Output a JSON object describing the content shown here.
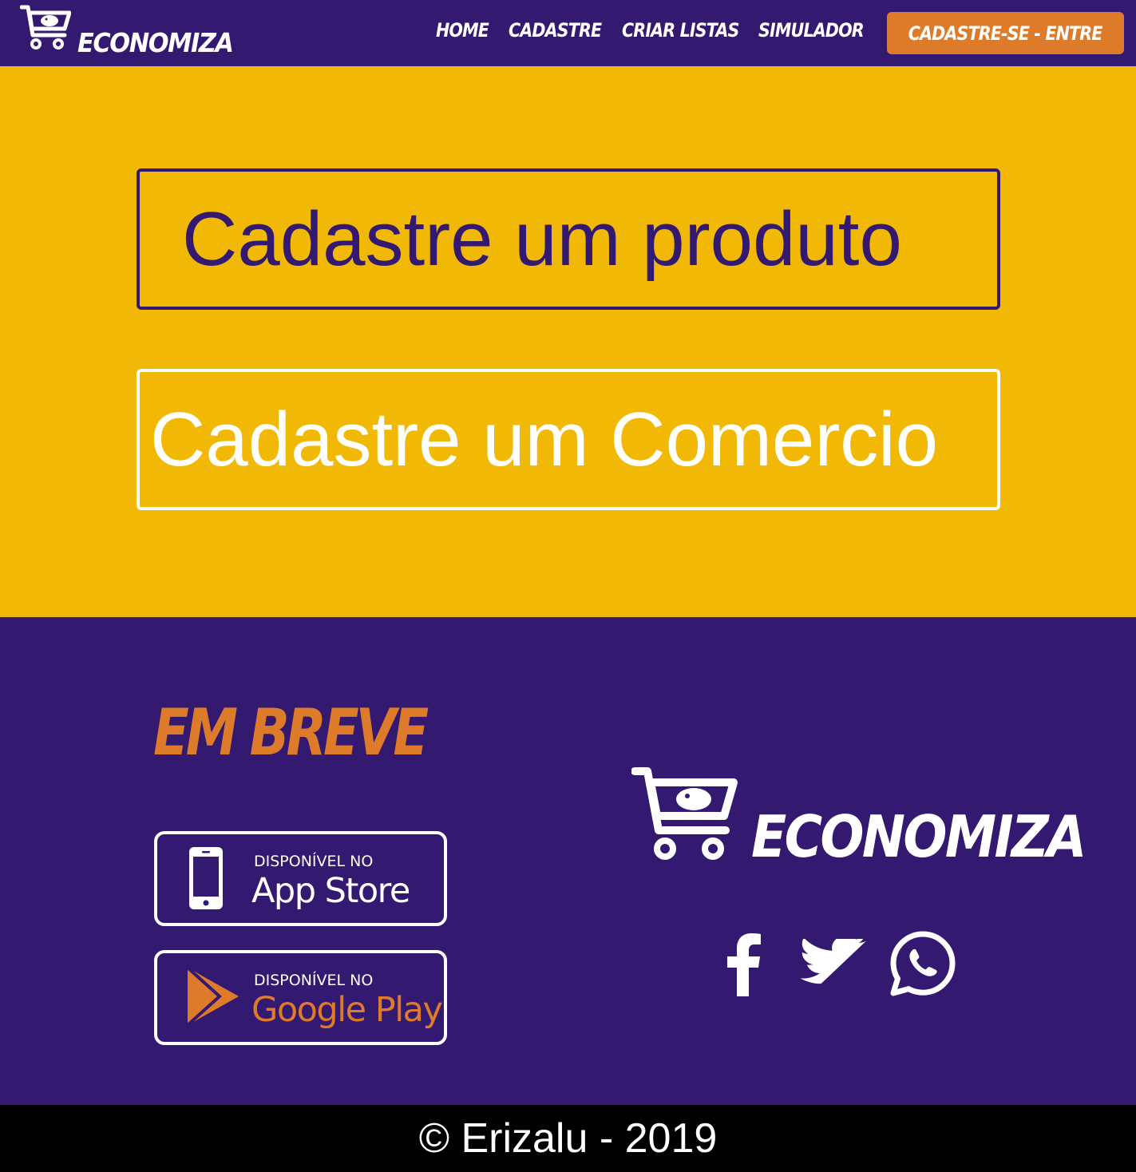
{
  "brand": {
    "name": "ECONOMIZA",
    "logo_icon": "shopping-cart-piggy-bank-icon"
  },
  "nav": {
    "items": [
      {
        "label": "HOME"
      },
      {
        "label": "CADASTRE"
      },
      {
        "label": "CRIAR LISTAS"
      },
      {
        "label": "SIMULADOR"
      }
    ],
    "cta_label": "CADASTRE-SE - ENTRE"
  },
  "hero": {
    "buttons": [
      {
        "label": "Cadastre um produto"
      },
      {
        "label": "Cadastre um Comercio"
      }
    ]
  },
  "footer": {
    "coming_soon": "EM BREVE",
    "badges": [
      {
        "small": "DISPONÍVEL NO",
        "big": "App Store",
        "icon": "smartphone-icon"
      },
      {
        "small": "DISPONÍVEL NO",
        "big": "Google Play",
        "icon": "google-play-icon"
      }
    ],
    "brand_name": "ECONOMIZA",
    "social": [
      "facebook-icon",
      "twitter-icon",
      "whatsapp-icon"
    ]
  },
  "copyright": "© Erizalu - 2019",
  "colors": {
    "purple": "#331970",
    "yellow": "#f1b806",
    "orange": "#dd7b2a",
    "white": "#ffffff",
    "black": "#000000"
  }
}
